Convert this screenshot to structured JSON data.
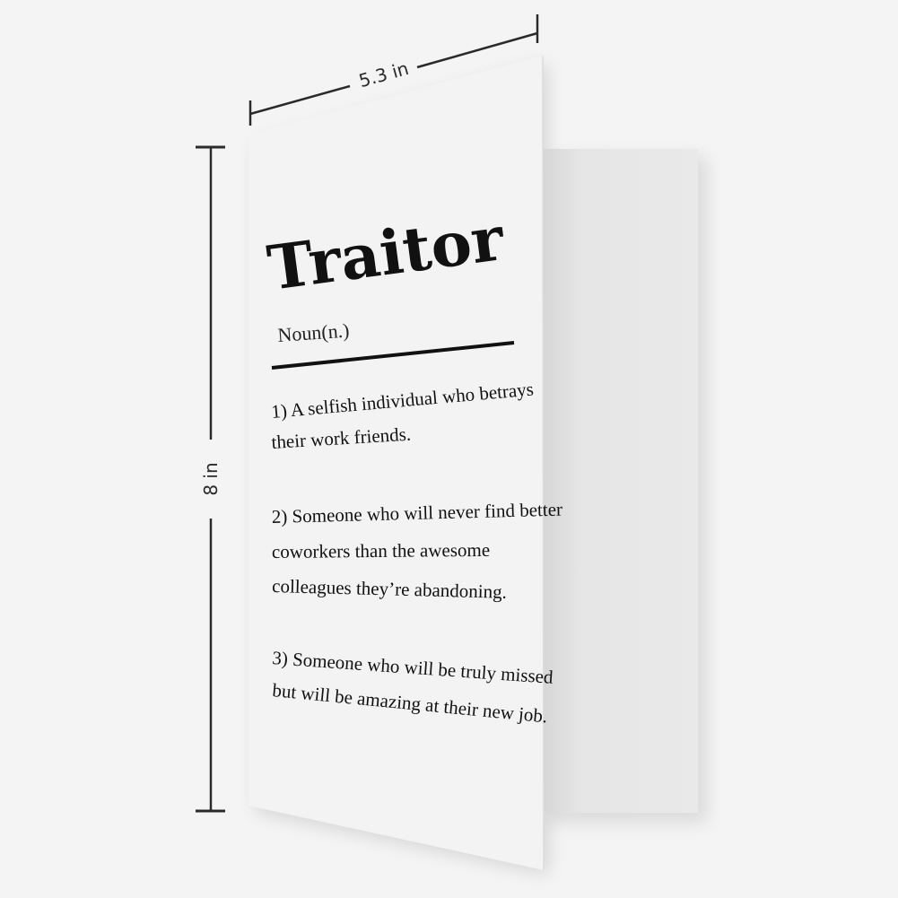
{
  "dimensions": {
    "width_label": "5.3 in",
    "height_label": "8 in"
  },
  "card": {
    "title": "Traitor",
    "part_of_speech": "Noun(n.)",
    "definitions": [
      [
        "1) A selfish individual who betrays",
        "their work friends."
      ],
      [
        "2) Someone who will never find better",
        "coworkers than the awesome",
        "colleagues they’re abandoning."
      ],
      [
        "3) Someone who will be truly missed",
        "but will be amazing at their new job."
      ]
    ]
  },
  "colors": {
    "background": "#f4f4f4",
    "card_front": "#f3f3f3",
    "card_back": "#e3e3e3",
    "ink": "#111111"
  }
}
